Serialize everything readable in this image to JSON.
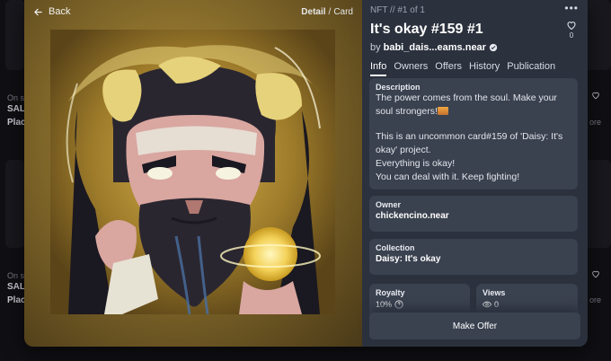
{
  "background": {
    "left_texts": [
      "On s",
      "SAL",
      "Plac",
      "On s",
      "SAL",
      "Plac"
    ],
    "right_texts": [
      "ore",
      "ore"
    ]
  },
  "nav": {
    "back_label": "Back",
    "breadcrumb": {
      "current": "Detail",
      "separator": "/",
      "next": "Card"
    }
  },
  "artwork": {
    "icon": "nft-artwork-warrior-portrait"
  },
  "detail": {
    "meta": "NFT // #1 of 1",
    "more_label": "•••",
    "title": "It's okay #159 #1",
    "like_count": "0",
    "byline_prefix": "by",
    "creator": "babi_dais...eams.near",
    "tabs": [
      {
        "label": "Info",
        "active": true
      },
      {
        "label": "Owners",
        "active": false
      },
      {
        "label": "Offers",
        "active": false
      },
      {
        "label": "History",
        "active": false
      },
      {
        "label": "Publication",
        "active": false
      }
    ],
    "description": {
      "heading": "Description",
      "line1": "The power comes from the soul. Make your soul strongers!",
      "line2": "This is an uncommon card#159 of 'Daisy: It's okay' project.",
      "line3": "Everything is okay!",
      "line4": "You can deal with it. Keep fighting!"
    },
    "owner": {
      "heading": "Owner",
      "value": "chickencino.near"
    },
    "collection": {
      "heading": "Collection",
      "value": "Daisy: It's okay"
    },
    "royalty": {
      "heading": "Royalty",
      "value": "10%"
    },
    "views": {
      "heading": "Views",
      "value": "0"
    },
    "offer_button": "Make Offer"
  },
  "colors": {
    "panel": "#2b313d",
    "card": "#3a414f",
    "accent_gold": "#e8d27a"
  }
}
